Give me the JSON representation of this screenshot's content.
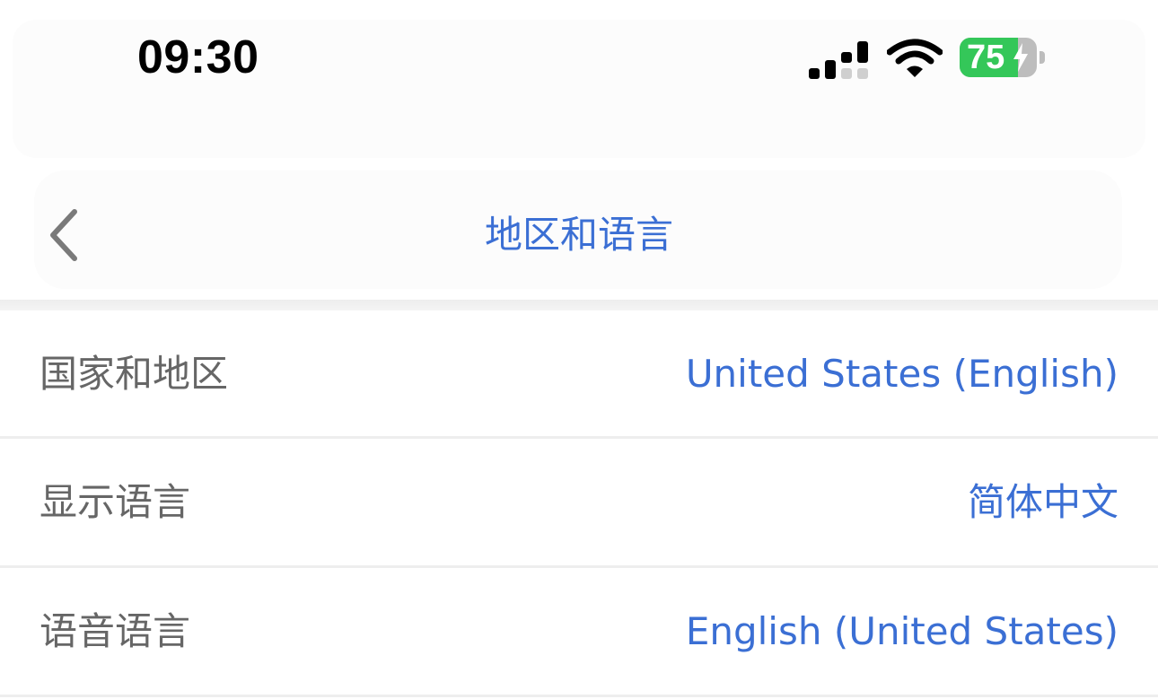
{
  "status_bar": {
    "time": "09:30",
    "battery_percent": "75",
    "battery_level": 0.75,
    "charging": true
  },
  "nav": {
    "back_icon": "chevron-left-icon",
    "title": "地区和语言"
  },
  "settings": [
    {
      "label": "国家和地区",
      "value": "United States (English)"
    },
    {
      "label": "显示语言",
      "value": "简体中文"
    },
    {
      "label": "语音语言",
      "value": "English (United States)"
    }
  ],
  "colors": {
    "accent": "#3b6fd4",
    "label": "#666666",
    "battery": "#34c759"
  }
}
